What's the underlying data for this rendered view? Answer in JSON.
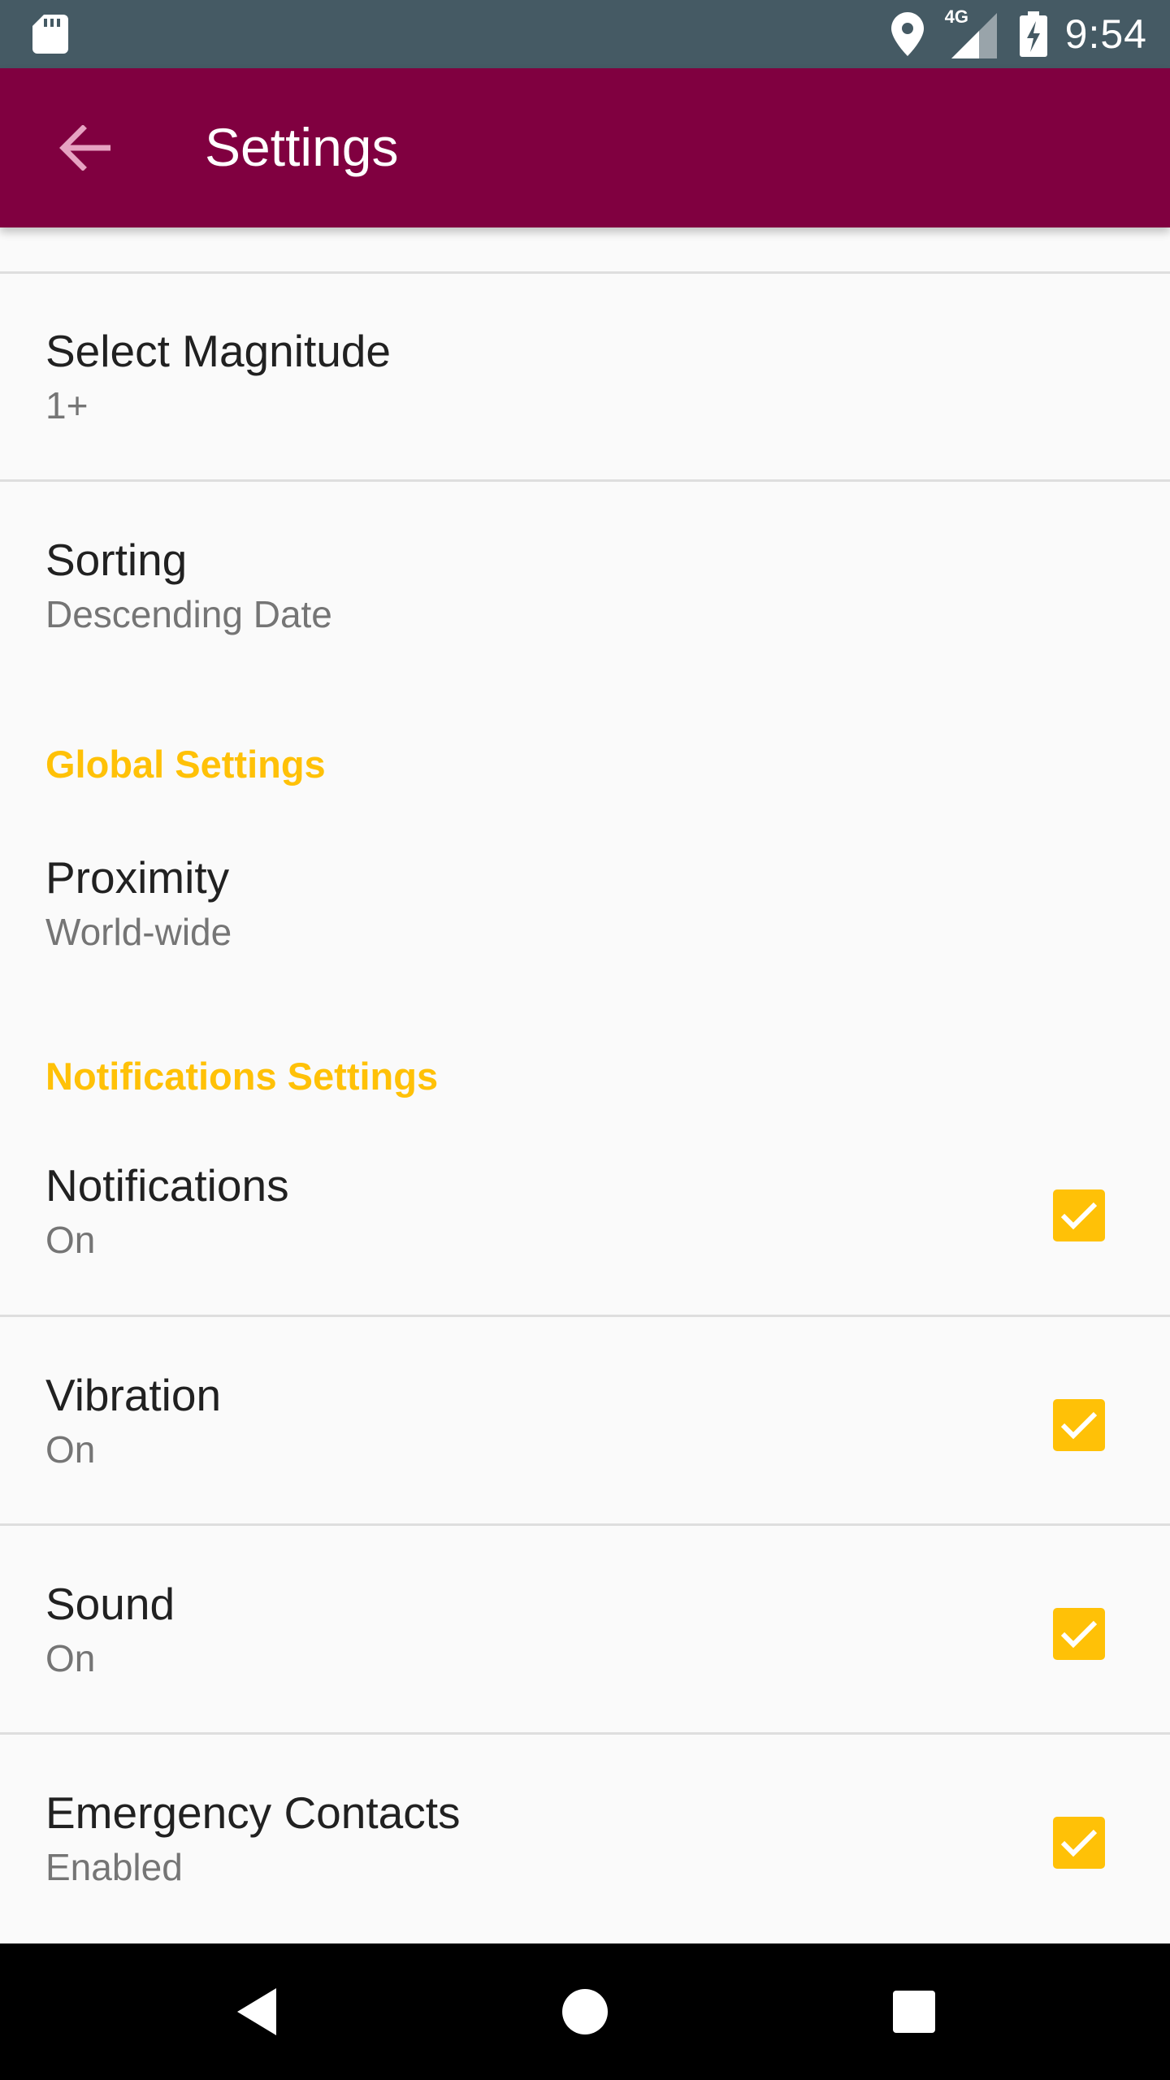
{
  "status_bar": {
    "network": "4G",
    "time": "9:54"
  },
  "app_bar": {
    "title": "Settings",
    "back_icon": "arrow-back-icon"
  },
  "colors": {
    "status_bar": "#455A64",
    "app_bar": "#800040",
    "accent": "#FFC107",
    "background": "#FAFAFA"
  },
  "preferences": {
    "magnitude": {
      "title": "Select Magnitude",
      "summary": "1+"
    },
    "sorting": {
      "title": "Sorting",
      "summary": "Descending Date"
    },
    "global_category": "Global Settings",
    "proximity": {
      "title": "Proximity",
      "summary": "World-wide"
    },
    "notifications_category": "Notifications Settings",
    "notifications": {
      "title": "Notifications",
      "summary": "On",
      "checked": true
    },
    "vibration": {
      "title": "Vibration",
      "summary": "On",
      "checked": true
    },
    "sound": {
      "title": "Sound",
      "summary": "On",
      "checked": true
    },
    "emergency": {
      "title": "Emergency Contacts",
      "summary": "Enabled",
      "checked": true
    }
  },
  "nav_bar": {
    "back_icon": "nav-back-icon",
    "home_icon": "nav-home-icon",
    "recents_icon": "nav-recents-icon"
  }
}
